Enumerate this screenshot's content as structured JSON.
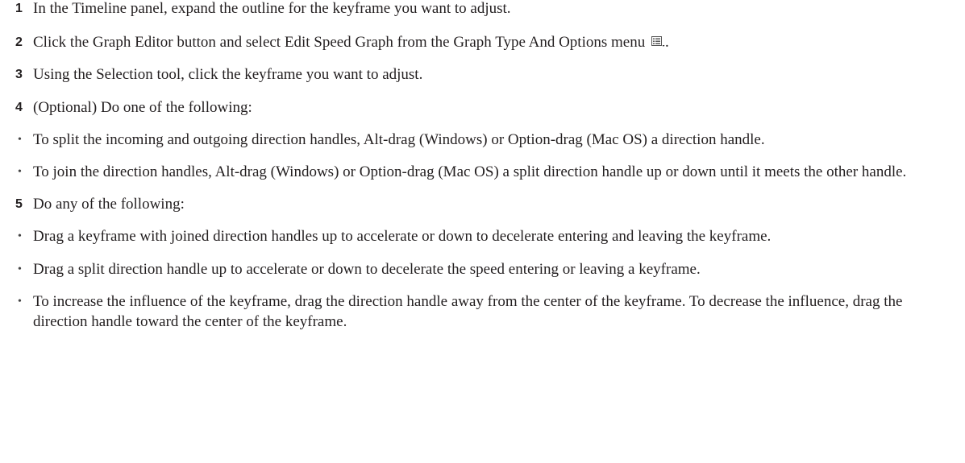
{
  "steps": [
    {
      "marker": "1",
      "text": "In the Timeline panel, expand the outline for the keyframe you want to adjust."
    },
    {
      "marker": "2",
      "text": "Click the Graph Editor button and select Edit Speed Graph from the Graph Type And Options menu",
      "icon": "graph-type-options-menu-icon",
      "after": "."
    },
    {
      "marker": "3",
      "text": "Using the Selection tool, click the keyframe you want to adjust."
    },
    {
      "marker": "4",
      "text": "(Optional) Do one of the following:"
    },
    {
      "marker": "•",
      "text": "To split the incoming and outgoing direction handles, Alt-drag (Windows) or Option-drag (Mac OS) a direction handle."
    },
    {
      "marker": "•",
      "text": "To join the direction handles, Alt-drag (Windows) or Option-drag (Mac OS) a split direction handle up or down until it meets the other handle."
    },
    {
      "marker": "5",
      "text": "Do any of the following:"
    },
    {
      "marker": "•",
      "text": "Drag a keyframe with joined direction handles up to accelerate or down to decelerate entering and leaving the keyframe."
    },
    {
      "marker": "•",
      "text": "Drag a split direction handle up to accelerate or down to decelerate the speed entering or leaving a keyframe."
    },
    {
      "marker": "•",
      "text": "To increase the influence of the keyframe, drag the direction handle away from the center of the keyframe. To decrease the influence, drag the direction handle toward the center of the keyframe."
    }
  ]
}
